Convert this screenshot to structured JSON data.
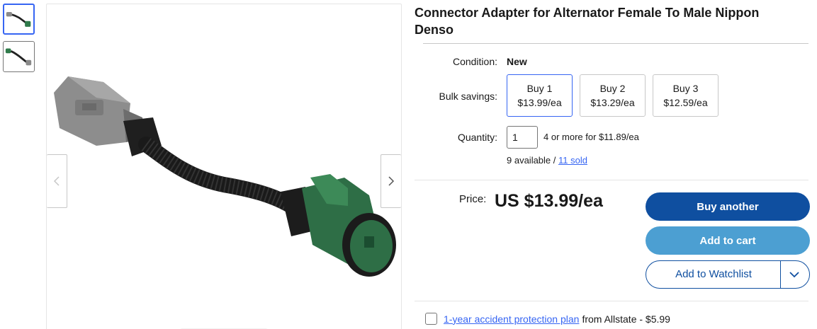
{
  "thumbnails": [
    {
      "icon": "connector-thumbnail-1",
      "selected": true
    },
    {
      "icon": "connector-thumbnail-2",
      "selected": false
    }
  ],
  "gallery": {
    "prev_icon": "chevron-left-icon",
    "next_icon": "chevron-right-icon"
  },
  "product": {
    "title": "Connector Adapter for Alternator Female To Male Nippon Denso"
  },
  "condition": {
    "label": "Condition:",
    "value": "New"
  },
  "bulk": {
    "label": "Bulk savings:",
    "options": [
      {
        "line1": "Buy 1",
        "line2": "$13.99/ea",
        "selected": true
      },
      {
        "line1": "Buy 2",
        "line2": "$13.29/ea",
        "selected": false
      },
      {
        "line1": "Buy 3",
        "line2": "$12.59/ea",
        "selected": false
      }
    ]
  },
  "quantity": {
    "label": "Quantity:",
    "value": "1",
    "note": "4 or more for $11.89/ea",
    "available": "9 available / ",
    "sold_link": "11 sold"
  },
  "price": {
    "label": "Price:",
    "value": "US $13.99/ea"
  },
  "actions": {
    "buy_label": "Buy another",
    "cart_label": "Add to cart",
    "watch_label": "Add to Watchlist",
    "watch_icon": "chevron-down-icon"
  },
  "protection": {
    "link": "1-year accident protection plan",
    "rest": "from Allstate - $5.99"
  },
  "colors": {
    "primary": "#0f4fa0",
    "secondary": "#4c9fd2",
    "link": "#3665f3",
    "selected_border": "#3665f3"
  }
}
